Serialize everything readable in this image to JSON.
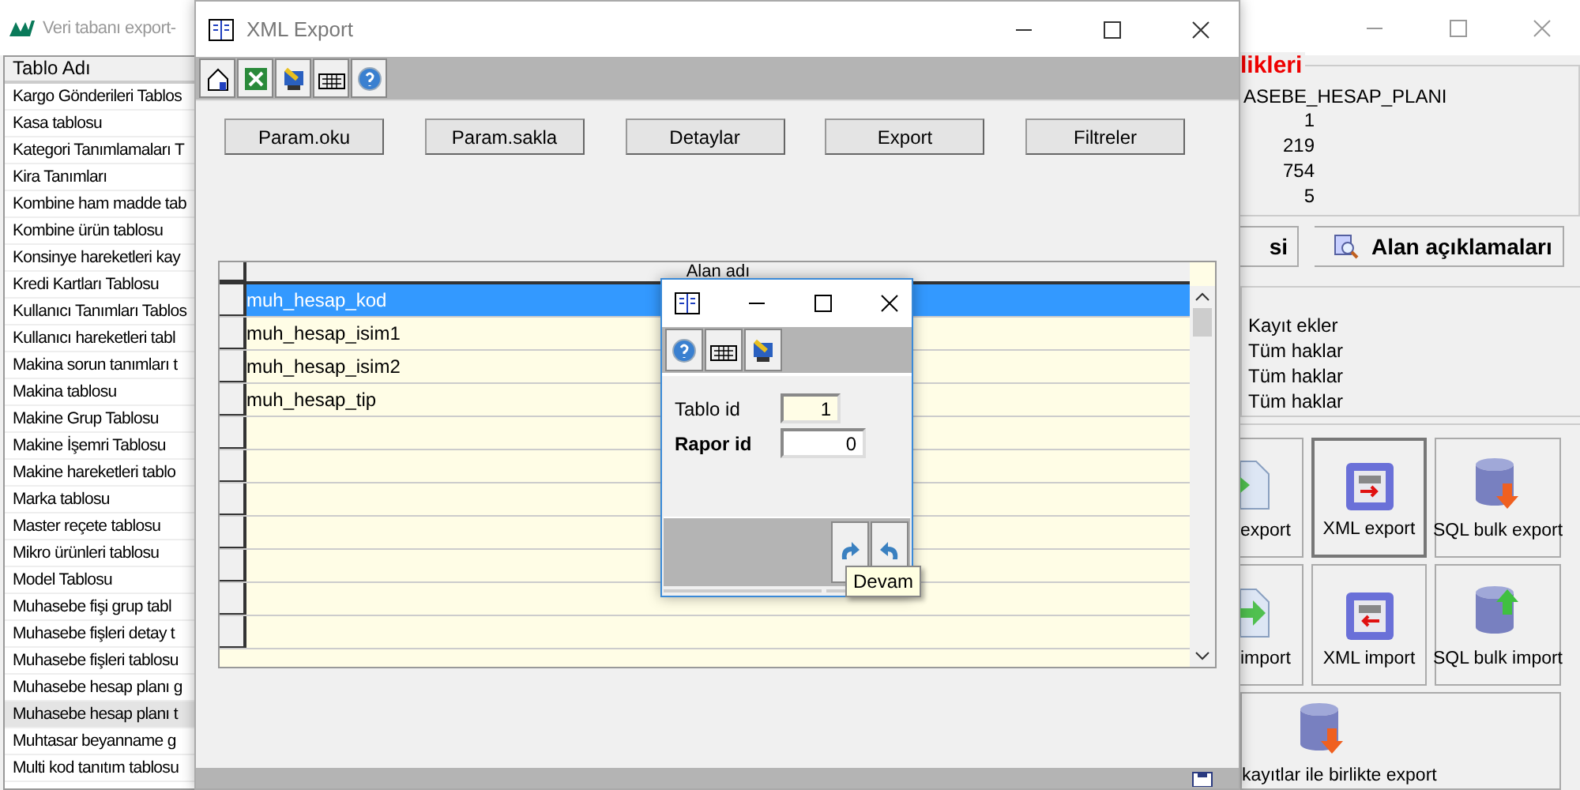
{
  "main_window": {
    "title": "Veri tabanı export-",
    "list": {
      "header": "Tablo Adı",
      "items": [
        {
          "label": "Kargo Gönderileri Tablos",
          "selected": false
        },
        {
          "label": "Kasa tablosu",
          "selected": false
        },
        {
          "label": "Kategori Tanımlamaları T",
          "selected": false
        },
        {
          "label": "Kira Tanımları",
          "selected": false
        },
        {
          "label": "Kombine ham madde tab",
          "selected": false
        },
        {
          "label": "Kombine ürün tablosu",
          "selected": false
        },
        {
          "label": "Konsinye hareketleri kay",
          "selected": false
        },
        {
          "label": "Kredi Kartları Tablosu",
          "selected": false
        },
        {
          "label": "Kullanıcı Tanımları Tablos",
          "selected": false
        },
        {
          "label": "Kullanıcı hareketleri tabl",
          "selected": false
        },
        {
          "label": "Makina sorun tanımları t",
          "selected": false
        },
        {
          "label": "Makina tablosu",
          "selected": false
        },
        {
          "label": "Makine Grup Tablosu",
          "selected": false
        },
        {
          "label": "Makine İşemri Tablosu",
          "selected": false
        },
        {
          "label": "Makine hareketleri tablo",
          "selected": false
        },
        {
          "label": "Marka tablosu",
          "selected": false
        },
        {
          "label": "Master reçete tablosu",
          "selected": false
        },
        {
          "label": "Mikro ürünleri tablosu",
          "selected": false
        },
        {
          "label": "Model Tablosu",
          "selected": false
        },
        {
          "label": "Muhasebe fişi grup tabl",
          "selected": false
        },
        {
          "label": "Muhasebe fişleri detay t",
          "selected": false
        },
        {
          "label": "Muhasebe fişleri tablosu",
          "selected": false
        },
        {
          "label": "Muhasebe hesap planı g",
          "selected": false
        },
        {
          "label": "Muhasebe hesap planı t",
          "selected": true
        },
        {
          "label": "Muhtasar beyanname g",
          "selected": false
        },
        {
          "label": "Multi kod tanıtım tablosu",
          "selected": false
        }
      ]
    },
    "properties": {
      "legend": "likleri",
      "table_name": "ASEBE_HESAP_PLANI",
      "numbers": [
        "1",
        "219",
        "754",
        "5"
      ]
    },
    "panel_buttons": [
      {
        "label": "si",
        "kind": "plain"
      },
      {
        "label": "Alan açıklamaları",
        "kind": "search"
      }
    ],
    "permissions": [
      "Kayıt ekler",
      "Tüm haklar",
      "Tüm haklar",
      "Tüm haklar"
    ],
    "actions": [
      {
        "label": "export",
        "kind": "file-export",
        "selected": false
      },
      {
        "label": "XML export",
        "kind": "xml-export",
        "selected": true
      },
      {
        "label": "SQL bulk export",
        "kind": "sql-export",
        "selected": false
      },
      {
        "label": "import",
        "kind": "file-import",
        "selected": false
      },
      {
        "label": "XML import",
        "kind": "xml-import",
        "selected": false
      },
      {
        "label": "SQL bulk import",
        "kind": "sql-import",
        "selected": false
      },
      {
        "label": "kayıtlar ile birlikte export",
        "kind": "db-export",
        "selected": false
      }
    ]
  },
  "xml_window": {
    "title": "XML Export",
    "buttons": [
      "Param.oku",
      "Param.sakla",
      "Detaylar",
      "Export",
      "Filtreler"
    ],
    "grid": {
      "header": "Alan adı",
      "rows": [
        {
          "text": "muh_hesap_kod",
          "selected": true
        },
        {
          "text": "muh_hesap_isim1",
          "selected": false
        },
        {
          "text": "muh_hesap_isim2",
          "selected": false
        },
        {
          "text": "muh_hesap_tip",
          "selected": false
        }
      ]
    }
  },
  "dialog": {
    "fields": [
      {
        "label": "Tablo id",
        "value": "1",
        "kind": "readonly"
      },
      {
        "label": "Rapor id",
        "value": "0",
        "kind": "required"
      }
    ],
    "tooltip": "Devam"
  }
}
